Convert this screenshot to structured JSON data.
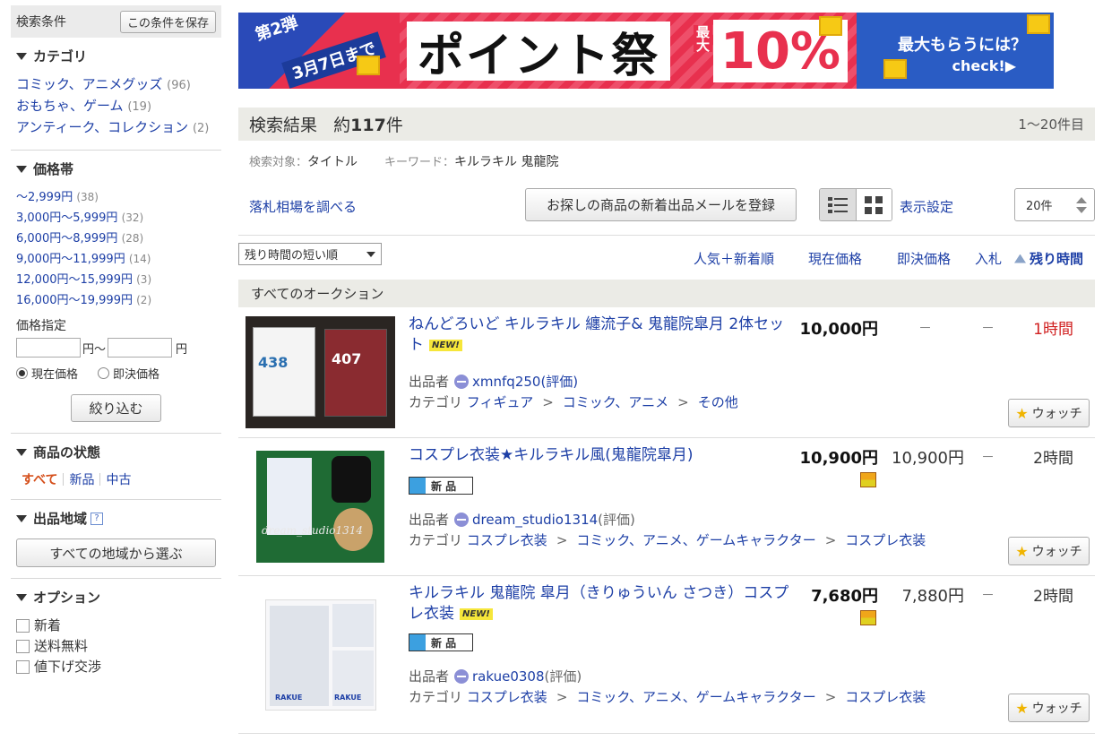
{
  "sidebar": {
    "search_conditions_label": "検索条件",
    "save_conditions_button": "この条件を保存",
    "category": {
      "title": "カテゴリ",
      "items": [
        {
          "label": "コミック、アニメグッズ",
          "count": "(96)"
        },
        {
          "label": "おもちゃ、ゲーム",
          "count": "(19)"
        },
        {
          "label": "アンティーク、コレクション",
          "count": "(2)"
        }
      ]
    },
    "price_band": {
      "title": "価格帯",
      "items": [
        {
          "label": "～2,999円",
          "count": "(38)"
        },
        {
          "label": "3,000円～5,999円",
          "count": "(32)"
        },
        {
          "label": "6,000円～8,999円",
          "count": "(28)"
        },
        {
          "label": "9,000円～11,999円",
          "count": "(14)"
        },
        {
          "label": "12,000円～15,999円",
          "count": "(3)"
        },
        {
          "label": "16,000円～19,999円",
          "count": "(2)"
        }
      ],
      "specify_label": "価格指定",
      "yen_from": "円～",
      "yen_to": "円",
      "radio_current": "現在価格",
      "radio_buynow": "即決価格",
      "narrow_button": "絞り込む"
    },
    "condition": {
      "title": "商品の状態",
      "all": "すべて",
      "new": "新品",
      "used": "中古"
    },
    "region": {
      "title": "出品地域",
      "help": "?",
      "button": "すべての地域から選ぶ"
    },
    "options": {
      "title": "オプション",
      "items": [
        "新着",
        "送料無料",
        "値下げ交渉"
      ]
    }
  },
  "banner": {
    "tag_round": "第2弾",
    "tag_date": "3月7日まで",
    "main": "ポイント祭",
    "max_label": "最大",
    "percent": "10%",
    "cta_line1": "最大もらうには？",
    "cta_line2": "check!▶"
  },
  "results": {
    "title": "検索結果",
    "count_prefix": "約",
    "count": "117",
    "count_suffix": "件",
    "range": "1～20件目",
    "target_label": "検索対象：",
    "target_value": "タイトル",
    "keyword_label": "キーワード：",
    "keyword_value": "キルラキル 鬼龍院"
  },
  "toolbar": {
    "market_link": "落札相場を調べる",
    "mail_button": "お探しの商品の新着出品メールを登録",
    "display_settings": "表示設定",
    "per_page": "20件"
  },
  "sort": {
    "selected": "残り時間の短い順",
    "popular": "人気＋新着順",
    "current_price": "現在価格",
    "buynow_price": "即決価格",
    "bids": "入札",
    "time_left": "残り時間"
  },
  "section_title": "すべてのオークション",
  "common": {
    "seller_label": "出品者",
    "rating_label": "(評価)",
    "category_label": "カテゴリ",
    "watch_label": "ウォッチ",
    "new_badge": "NEW!",
    "shinpin_label": "新 品",
    "dash": "－"
  },
  "items": [
    {
      "title": "ねんどろいど キルラキル 纏流子& 鬼龍院皐月 2体セット",
      "seller": "xmnfq250",
      "categories": [
        "フィギュア",
        "コミック、アニメ",
        "その他"
      ],
      "price": "10,000円",
      "buynow": "",
      "time_left": "1時間",
      "time_red": true,
      "thumb_nums": [
        "438",
        "407"
      ]
    },
    {
      "title": "コスプレ衣装★キルラキル風(鬼龍院皐月)",
      "seller": "dream_studio1314",
      "categories": [
        "コスプレ衣装",
        "コミック、アニメ、ゲームキャラクター",
        "コスプレ衣装"
      ],
      "price": "10,900円",
      "buynow": "10,900円",
      "time_left": "2時間",
      "time_red": false,
      "watermark": "dream_studio1314"
    },
    {
      "title": "キルラキル 鬼龍院 皐月（きりゅういん さつき）コスプレ衣装",
      "seller": "rakue0308",
      "categories": [
        "コスプレ衣装",
        "コミック、アニメ、ゲームキャラクター",
        "コスプレ衣装"
      ],
      "price": "7,680円",
      "buynow": "7,880円",
      "time_left": "2時間",
      "time_red": false,
      "brand": "RAKUE"
    }
  ]
}
